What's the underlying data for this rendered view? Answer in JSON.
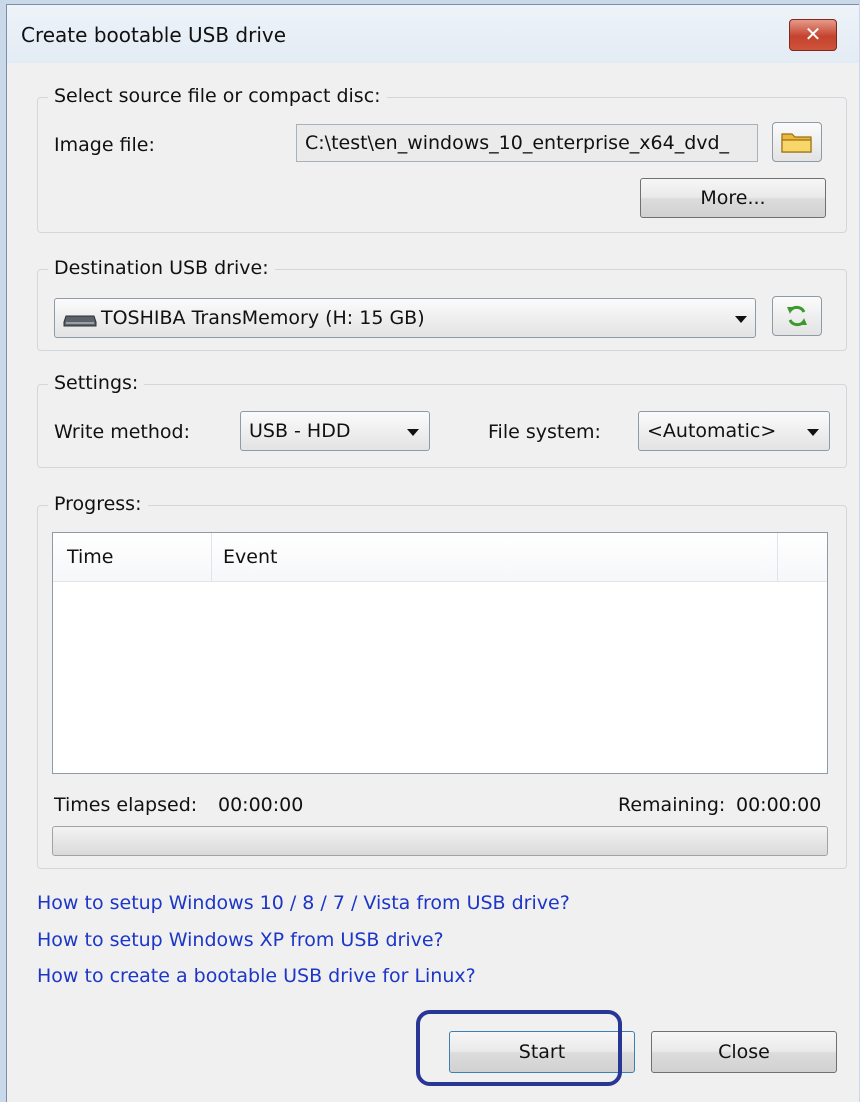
{
  "window": {
    "title": "Create bootable USB drive"
  },
  "source": {
    "legend": "Select source file or compact disc:",
    "image_label": "Image file:",
    "image_value": "C:\\test\\en_windows_10_enterprise_x64_dvd_",
    "more_label": "More..."
  },
  "destination": {
    "legend": "Destination USB drive:",
    "drive_value": "TOSHIBA TransMemory (H: 15 GB)"
  },
  "settings": {
    "legend": "Settings:",
    "write_method_label": "Write method:",
    "write_method_value": "USB - HDD",
    "file_system_label": "File system:",
    "file_system_value": "<Automatic>"
  },
  "progress": {
    "legend": "Progress:",
    "columns": [
      "Time",
      "Event"
    ],
    "elapsed_label": "Times elapsed:",
    "elapsed_value": "00:00:00",
    "remaining_label": "Remaining:",
    "remaining_value": "00:00:00",
    "percent": 0
  },
  "links": [
    "How to setup Windows 10 / 8 / 7 / Vista from USB drive?",
    "How to setup Windows XP from USB drive?",
    "How to create a bootable USB drive for Linux?"
  ],
  "buttons": {
    "start": "Start",
    "close": "Close"
  },
  "colors": {
    "link": "#1c36c7",
    "highlight": "#283694",
    "close_button": "#c4432e"
  }
}
